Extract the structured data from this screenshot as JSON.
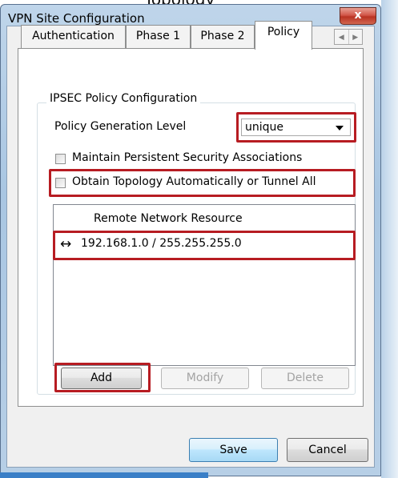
{
  "page_caption": "Topology",
  "window": {
    "title": "VPN Site Configuration",
    "close_glyph": "x"
  },
  "tabs": [
    {
      "label": "Authentication",
      "active": false
    },
    {
      "label": "Phase 1",
      "active": false
    },
    {
      "label": "Phase 2",
      "active": false
    },
    {
      "label": "Policy",
      "active": true
    }
  ],
  "tab_scroll": {
    "left": "◀",
    "right": "▶"
  },
  "group": {
    "title": "IPSEC Policy Configuration"
  },
  "policy_level": {
    "label": "Policy Generation Level",
    "value": "unique"
  },
  "checkboxes": [
    {
      "label": "Maintain Persistent Security Associations",
      "checked": false
    },
    {
      "label": "Obtain Topology Automatically or Tunnel All",
      "checked": false
    }
  ],
  "resources": {
    "header": "Remote Network Resource",
    "rows": [
      {
        "arrow": "↔",
        "value": "192.168.1.0 / 255.255.255.0"
      }
    ]
  },
  "list_buttons": {
    "add": "Add",
    "modify": "Modify",
    "delete": "Delete"
  },
  "dialog_buttons": {
    "save": "Save",
    "cancel": "Cancel"
  },
  "colors": {
    "highlight": "#b71c22",
    "frame": "#a9c6e2"
  }
}
